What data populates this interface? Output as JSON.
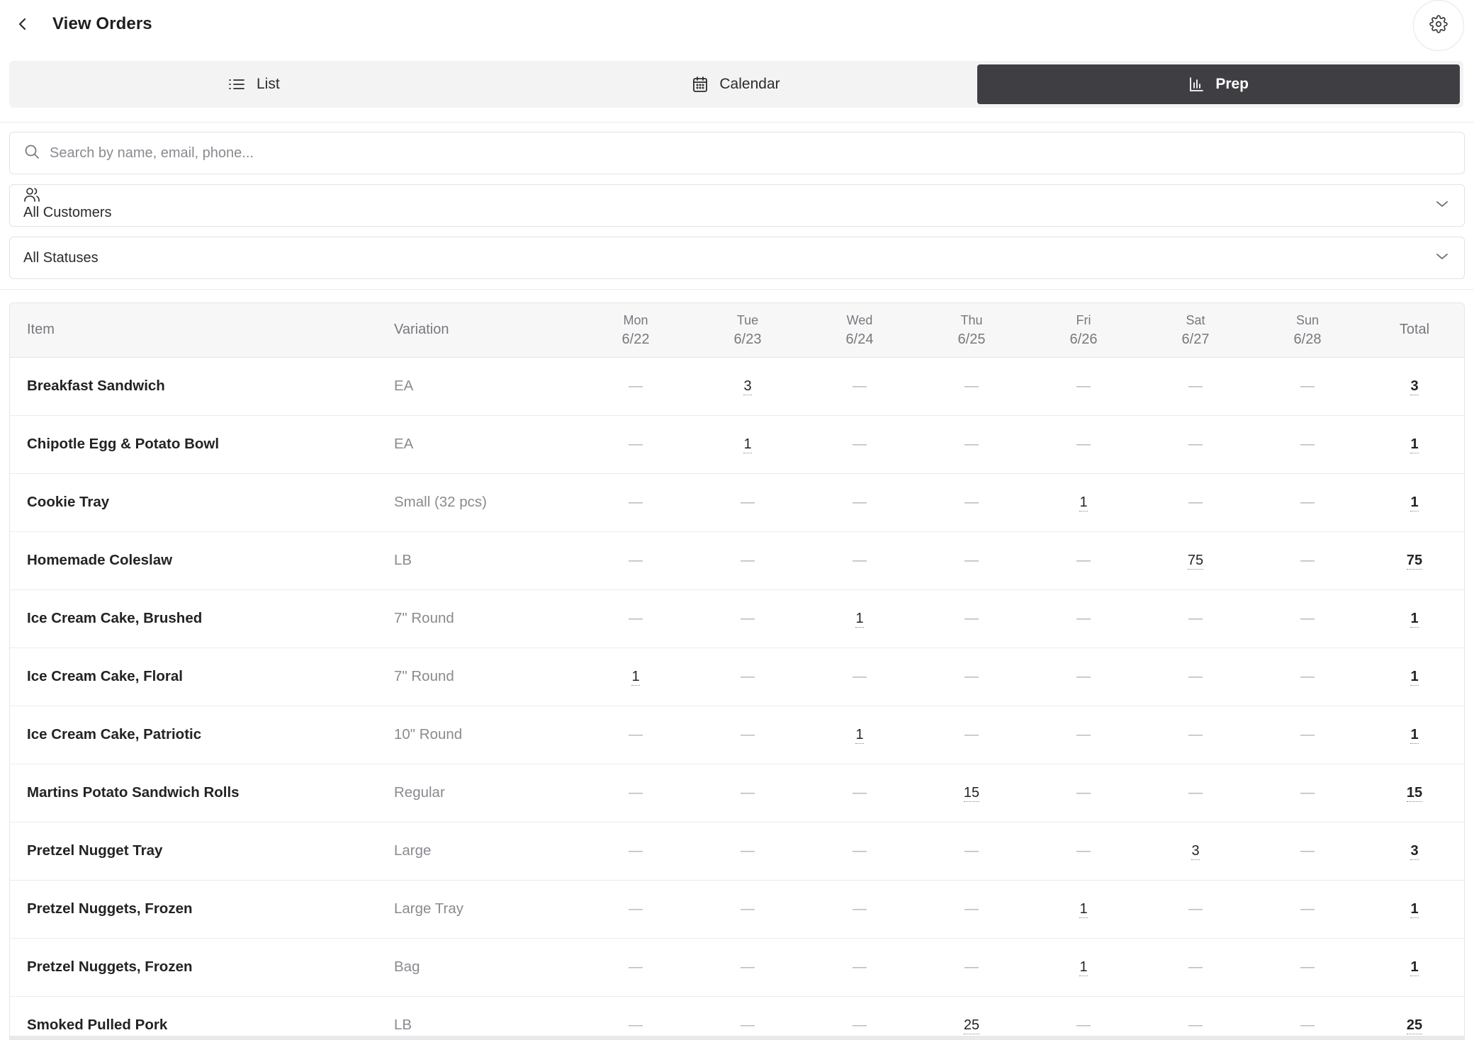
{
  "header": {
    "title": "View Orders"
  },
  "tabs": [
    {
      "label": "List",
      "icon": "list-icon",
      "active": false
    },
    {
      "label": "Calendar",
      "icon": "calendar-icon",
      "active": false
    },
    {
      "label": "Prep",
      "icon": "bar-chart-icon",
      "active": true
    }
  ],
  "filters": {
    "search_placeholder": "Search by name, email, phone...",
    "search_value": "",
    "customers_selected": "All Customers",
    "statuses_selected": "All Statuses"
  },
  "table": {
    "columns": {
      "item": "Item",
      "variation": "Variation",
      "days": [
        {
          "day": "Mon",
          "date": "6/22"
        },
        {
          "day": "Tue",
          "date": "6/23"
        },
        {
          "day": "Wed",
          "date": "6/24"
        },
        {
          "day": "Thu",
          "date": "6/25"
        },
        {
          "day": "Fri",
          "date": "6/26"
        },
        {
          "day": "Sat",
          "date": "6/27"
        },
        {
          "day": "Sun",
          "date": "6/28"
        }
      ],
      "total": "Total"
    },
    "empty_symbol": "—",
    "rows": [
      {
        "item": "Breakfast Sandwich",
        "variation": "EA",
        "values": [
          null,
          3,
          null,
          null,
          null,
          null,
          null
        ],
        "total": 3
      },
      {
        "item": "Chipotle Egg & Potato Bowl",
        "variation": "EA",
        "values": [
          null,
          1,
          null,
          null,
          null,
          null,
          null
        ],
        "total": 1
      },
      {
        "item": "Cookie Tray",
        "variation": "Small (32 pcs)",
        "values": [
          null,
          null,
          null,
          null,
          1,
          null,
          null
        ],
        "total": 1
      },
      {
        "item": "Homemade Coleslaw",
        "variation": "LB",
        "values": [
          null,
          null,
          null,
          null,
          null,
          75,
          null
        ],
        "total": 75
      },
      {
        "item": "Ice Cream Cake, Brushed",
        "variation": "7\" Round",
        "values": [
          null,
          null,
          1,
          null,
          null,
          null,
          null
        ],
        "total": 1
      },
      {
        "item": "Ice Cream Cake, Floral",
        "variation": "7\" Round",
        "values": [
          1,
          null,
          null,
          null,
          null,
          null,
          null
        ],
        "total": 1
      },
      {
        "item": "Ice Cream Cake, Patriotic",
        "variation": "10\" Round",
        "values": [
          null,
          null,
          1,
          null,
          null,
          null,
          null
        ],
        "total": 1
      },
      {
        "item": "Martins Potato Sandwich Rolls",
        "variation": "Regular",
        "values": [
          null,
          null,
          null,
          15,
          null,
          null,
          null
        ],
        "total": 15
      },
      {
        "item": "Pretzel Nugget Tray",
        "variation": "Large",
        "values": [
          null,
          null,
          null,
          null,
          null,
          3,
          null
        ],
        "total": 3
      },
      {
        "item": "Pretzel Nuggets, Frozen",
        "variation": "Large Tray",
        "values": [
          null,
          null,
          null,
          null,
          1,
          null,
          null
        ],
        "total": 1
      },
      {
        "item": "Pretzel Nuggets, Frozen",
        "variation": "Bag",
        "values": [
          null,
          null,
          null,
          null,
          1,
          null,
          null
        ],
        "total": 1
      },
      {
        "item": "Smoked Pulled Pork",
        "variation": "LB",
        "values": [
          null,
          null,
          null,
          25,
          null,
          null,
          null
        ],
        "total": 25
      }
    ]
  }
}
